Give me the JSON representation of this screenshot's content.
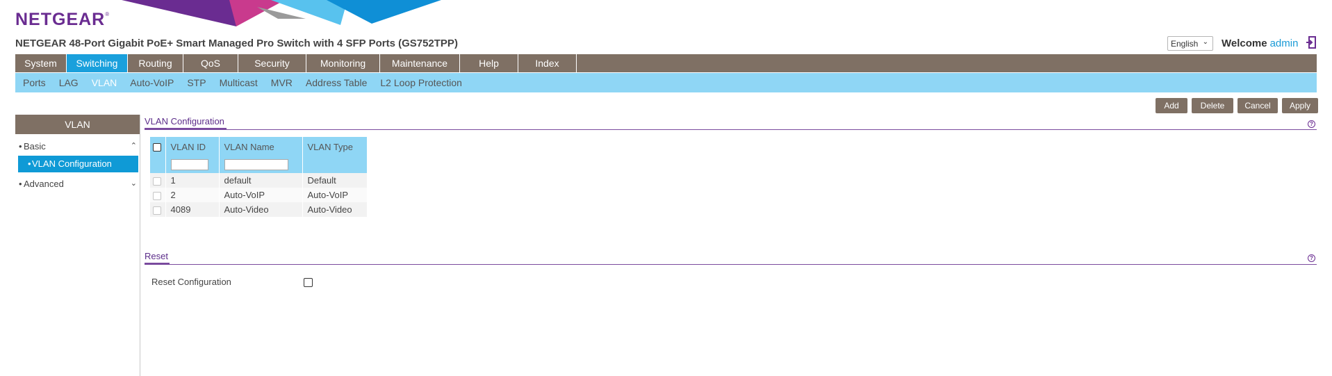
{
  "brand": {
    "logo": "NETGEAR",
    "trademark": "®"
  },
  "header": {
    "product_title": "NETGEAR 48-Port Gigabit PoE+ Smart Managed Pro Switch with 4 SFP Ports (GS752TPP)",
    "language": "English",
    "welcome_label": "Welcome",
    "username": "admin"
  },
  "top_nav": [
    {
      "label": "System",
      "active": false
    },
    {
      "label": "Switching",
      "active": true
    },
    {
      "label": "Routing",
      "active": false
    },
    {
      "label": "QoS",
      "active": false
    },
    {
      "label": "Security",
      "active": false
    },
    {
      "label": "Monitoring",
      "active": false
    },
    {
      "label": "Maintenance",
      "active": false
    },
    {
      "label": "Help",
      "active": false
    },
    {
      "label": "Index",
      "active": false
    }
  ],
  "sub_nav": [
    {
      "label": "Ports",
      "active": false
    },
    {
      "label": "LAG",
      "active": false
    },
    {
      "label": "VLAN",
      "active": true
    },
    {
      "label": "Auto-VoIP",
      "active": false
    },
    {
      "label": "STP",
      "active": false
    },
    {
      "label": "Multicast",
      "active": false
    },
    {
      "label": "MVR",
      "active": false
    },
    {
      "label": "Address Table",
      "active": false
    },
    {
      "label": "L2 Loop Protection",
      "active": false
    }
  ],
  "sidebar": {
    "title": "VLAN",
    "groups": [
      {
        "label": "Basic",
        "expanded": true,
        "items": [
          {
            "label": "VLAN Configuration",
            "active": true
          }
        ]
      },
      {
        "label": "Advanced",
        "expanded": false,
        "items": []
      }
    ]
  },
  "actions": {
    "add": "Add",
    "delete": "Delete",
    "cancel": "Cancel",
    "apply": "Apply"
  },
  "vlan_config": {
    "title": "VLAN Configuration",
    "columns": [
      "VLAN ID",
      "VLAN Name",
      "VLAN Type"
    ],
    "rows": [
      {
        "id": "1",
        "name": "default",
        "type": "Default"
      },
      {
        "id": "2",
        "name": "Auto-VoIP",
        "type": "Auto-VoIP"
      },
      {
        "id": "4089",
        "name": "Auto-Video",
        "type": "Auto-Video"
      }
    ]
  },
  "reset": {
    "title": "Reset",
    "label": "Reset Configuration"
  },
  "colors": {
    "brand_purple": "#6a2c91",
    "nav_gray": "#7f7064",
    "active_blue": "#1aa0dc",
    "subnav_blue": "#8fd6f5"
  }
}
